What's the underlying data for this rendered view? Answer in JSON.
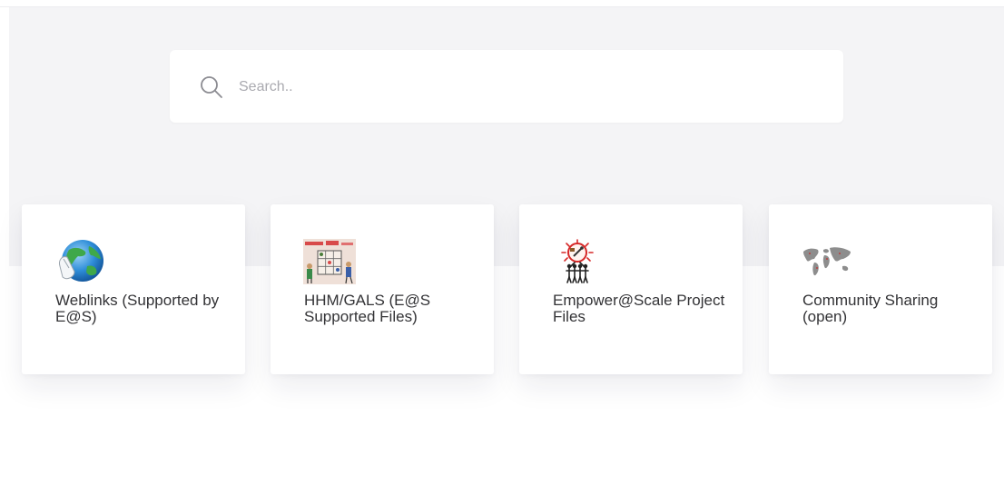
{
  "search": {
    "placeholder": "Search.."
  },
  "categories": [
    {
      "label": "Weblinks (Supported by E@S)",
      "icon": "globe-mouse-icon"
    },
    {
      "label": "HHM/GALS (E@S Supported Files)",
      "icon": "drawing-thumbnail-icon"
    },
    {
      "label": "Empower@Scale Project Files",
      "icon": "empower-scale-logo-icon"
    },
    {
      "label": "Community Sharing (open)",
      "icon": "world-map-icon"
    }
  ],
  "colors": {
    "hero_background": "#f4f4f6",
    "card_background": "#ffffff",
    "text": "#333336",
    "placeholder": "#aaaab0"
  }
}
